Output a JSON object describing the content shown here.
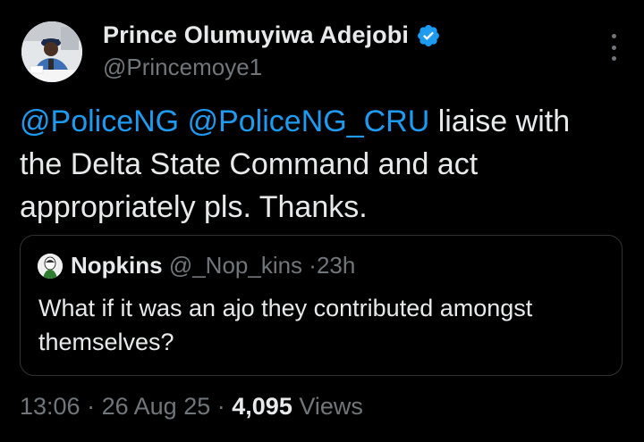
{
  "tweet": {
    "author": {
      "display_name": "Prince Olumuyiwa Adejobi",
      "handle": "@Princemoye1",
      "verified_icon": "verified-badge-icon",
      "verified_color": "#1d9bf0"
    },
    "more_icon": "more-options-icon",
    "text": {
      "mention_1": "@PoliceNG",
      "mention_2": "@PoliceNG_CRU",
      "body": " liaise with the Delta State Command and act appropriately pls. Thanks."
    },
    "quoted": {
      "display_name": "Nopkins",
      "handle": "@_Nop_kins",
      "separator": "·",
      "time": "23h",
      "text": "What if it was an ajo they contributed amongst themselves?"
    },
    "footer": {
      "time": "13:06",
      "separator_1": "·",
      "date": "26 Aug 25",
      "separator_2": "·",
      "views_count": "4,095",
      "views_label": "Views"
    }
  },
  "colors": {
    "background": "#000000",
    "text": "#e7e9ea",
    "secondary": "#71767b",
    "link": "#1d9bf0",
    "border": "#2f3336"
  }
}
